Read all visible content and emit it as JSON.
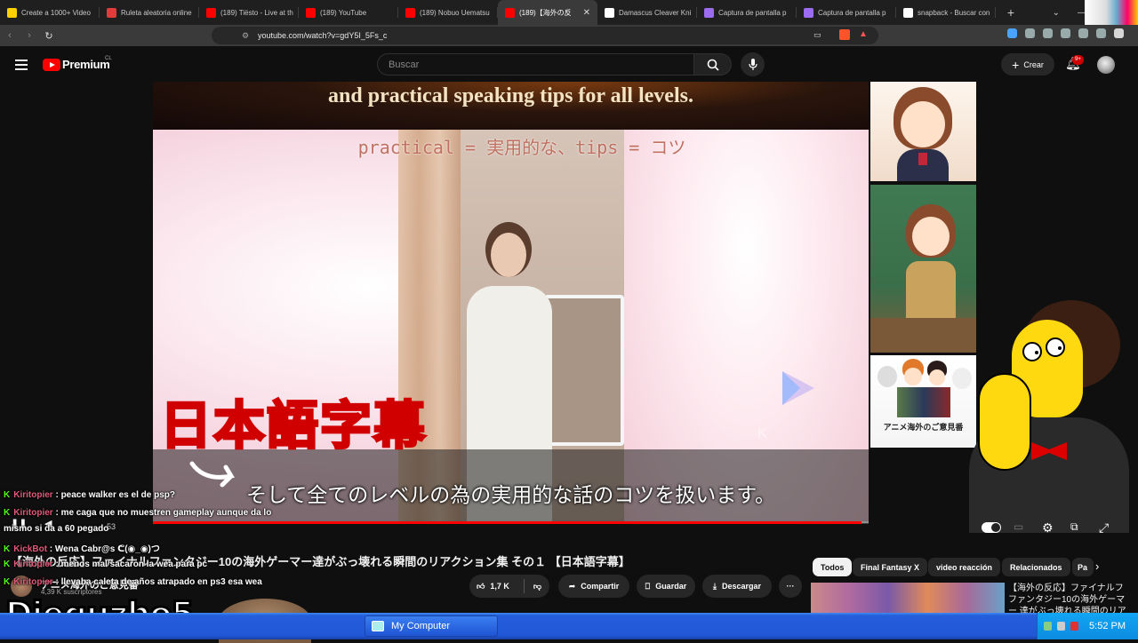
{
  "browser": {
    "tabs": [
      {
        "label": "Create a 1000+ Video",
        "fav": "#ffd000",
        "fav_icon": "spark-icon"
      },
      {
        "label": "Ruleta aleatoria online",
        "fav": "#e13b3b",
        "fav_icon": "wheel-icon"
      },
      {
        "label": "(189) Tiësto - Live at th",
        "fav": "#ff0000",
        "fav_icon": "youtube-icon"
      },
      {
        "label": "(189) YouTube",
        "fav": "#ff0000",
        "fav_icon": "youtube-icon"
      },
      {
        "label": "(189) Nobuo Uematsu",
        "fav": "#ff0000",
        "fav_icon": "youtube-icon"
      },
      {
        "label": "(189)【海外の反",
        "fav": "#ff0000",
        "fav_icon": "youtube-icon",
        "active": true
      },
      {
        "label": "Damascus Cleaver Kni",
        "fav": "#ffffff",
        "fav_icon": "page-icon"
      },
      {
        "label": "Captura de pantalla p",
        "fav": "#9b6cf0",
        "fav_icon": "pen-icon"
      },
      {
        "label": "Captura de pantalla p",
        "fav": "#9b6cf0",
        "fav_icon": "pen-icon"
      },
      {
        "label": "snapback - Buscar con",
        "fav": "#ffffff",
        "fav_icon": "google-icon"
      }
    ],
    "url": "youtube.com/watch?v=gdY5I_5Fs_c"
  },
  "youtube": {
    "brand": "Premium",
    "country": "CL",
    "search_placeholder": "Buscar",
    "create_label": "Crear",
    "notif_badge": "9+",
    "video": {
      "top_banner": "and practical speaking tips for all levels.",
      "gloss": "practical = 実用的な、tips = コツ",
      "jp_title_overlay": "日本語字幕",
      "caption": "そして全てのレベルの為の実用的な話のコツを扱います。",
      "watermark": "K",
      "progress_fraction": 0.99
    },
    "time_readout": "53",
    "title": "【海外の反応】ファイナルファンタジー10の海外ゲーマー達がぶっ壊れる瞬間のリアクション集 その１ 【日本語字幕】",
    "channel": {
      "name": "アニメ海外のご意見番",
      "subs": "4,39 K suscriptores"
    },
    "actions": {
      "likes": "1,7 K",
      "share": "Compartir",
      "save": "Guardar",
      "download": "Descargar",
      "more": "···"
    },
    "chips": [
      "Todos",
      "Final Fantasy X",
      "video reacción",
      "Relacionados",
      "Pa"
    ],
    "next_video_title": "【海外の反応】ファイナルフ ファンタジー10の海外ゲーマー 達がぶっ壊れる瞬間のリア",
    "side_art_caption": "アニメ海外のご意見番"
  },
  "chat": [
    {
      "user": "Kiritopier",
      "platform": "kick",
      "message": "peace walker es el de psp?"
    },
    {
      "user": "Kiritopier",
      "platform": "kick",
      "message": "me caga que no muestren gameplay aunque da lo"
    },
    {
      "user": "",
      "platform": "",
      "message": "mismo si da a 60 pegado"
    },
    {
      "user": "KickBot",
      "platform": "kick",
      "message": "Wena Cabr@s ᕦ(◉_◉)つ"
    },
    {
      "user": "Kiritopier",
      "platform": "kick",
      "message": "menos mal sacaron la wea para pc"
    },
    {
      "user": "Kiritopier",
      "platform": "kick",
      "message": "llevaba caleta de años atrapado en ps3 esa wea"
    }
  ],
  "streamer": "Dieguzho5",
  "taskbar": {
    "window": "My Computer",
    "clock": "5:52 PM"
  },
  "colors": {
    "yt_red": "#ff0000",
    "kick_green": "#53fc18",
    "xp_blue": "#245edb"
  }
}
